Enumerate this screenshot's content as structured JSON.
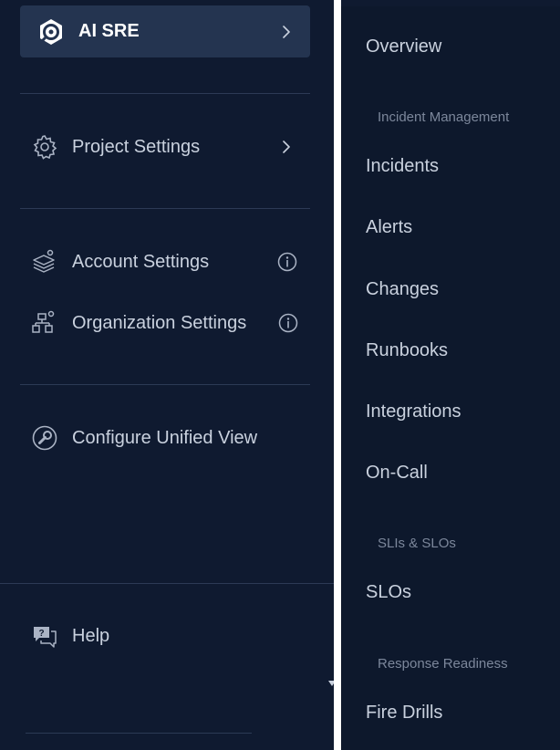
{
  "module": {
    "label": "AI SRE",
    "icon": "ai-sre-logo-icon"
  },
  "nav": {
    "project_settings": "Project Settings",
    "account_settings": "Account Settings",
    "organization_settings": "Organization Settings",
    "configure_unified_view": "Configure Unified View",
    "help": "Help"
  },
  "flyout": {
    "overview": "Overview",
    "incident_management_header": "Incident Management",
    "incidents": "Incidents",
    "alerts": "Alerts",
    "changes": "Changes",
    "runbooks": "Runbooks",
    "integrations": "Integrations",
    "on_call": "On-Call",
    "slis_slos_header": "SLIs & SLOs",
    "slos": "SLOs",
    "response_readiness_header": "Response Readiness",
    "fire_drills": "Fire Drills"
  },
  "colors": {
    "sidebar_bg": "#0f1a30",
    "flyout_bg": "#0d182c",
    "active_module_bg": "#243450",
    "text": "#c9d1de",
    "section_header": "#7c879b"
  }
}
